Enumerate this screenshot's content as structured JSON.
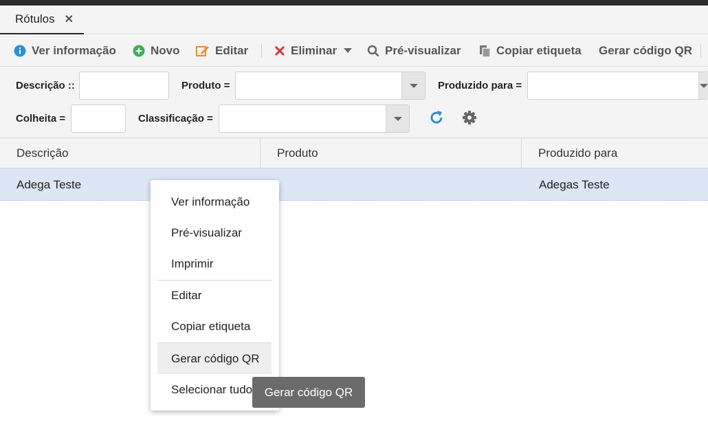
{
  "tab": {
    "title": "Rótulos",
    "close_glyph": "✕"
  },
  "toolbar": {
    "info_label": "Ver informação",
    "new_label": "Novo",
    "edit_label": "Editar",
    "delete_label": "Eliminar",
    "preview_label": "Pré-visualizar",
    "copy_label": "Copiar etiqueta",
    "qr_label": "Gerar código QR"
  },
  "filters": {
    "descricao_label": "Descrição ::",
    "descricao_value": "",
    "produto_label": "Produto =",
    "produto_value": "",
    "produzido_label": "Produzido para =",
    "produzido_value": "",
    "colheita_label": "Colheita =",
    "colheita_value": "",
    "classificacao_label": "Classificação =",
    "classificacao_value": ""
  },
  "grid": {
    "columns": [
      "Descrição",
      "Produto",
      "Produzido para"
    ],
    "rows": [
      {
        "descricao": "Adega Teste",
        "produto": "",
        "produzido_para": "Adegas Teste"
      }
    ]
  },
  "context_menu": {
    "items": [
      "Ver informação",
      "Pré-visualizar",
      "Imprimir",
      "Editar",
      "Copiar etiqueta",
      "Gerar código QR",
      "Selecionar tudo"
    ]
  },
  "tooltip": {
    "text": "Gerar código QR"
  },
  "colors": {
    "info_blue": "#2a8fd6",
    "new_green": "#3cb054",
    "edit_orange": "#f08a24",
    "delete_red": "#e0302d",
    "selected_row": "#dce6f4",
    "refresh_blue": "#2a8fd6"
  },
  "icons": [
    "info-icon",
    "plus-icon",
    "edit-icon",
    "delete-icon",
    "caret-down-icon",
    "search-icon",
    "copy-icon",
    "close-icon",
    "refresh-icon",
    "gear-icon"
  ]
}
